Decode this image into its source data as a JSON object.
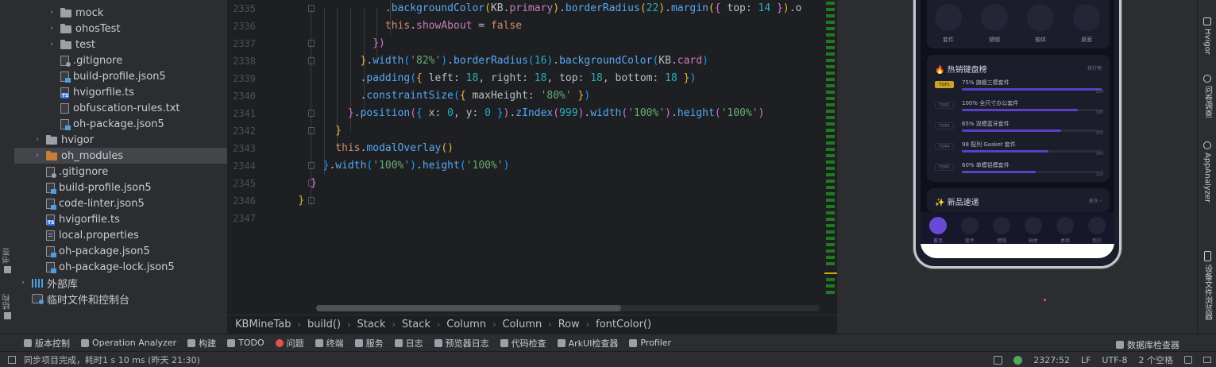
{
  "left_strip": {
    "bookmarks_label": "书签",
    "structure_label": "结构"
  },
  "tree": [
    {
      "label": "mock",
      "type": "folder",
      "chevron": "›",
      "indent": 3
    },
    {
      "label": "ohosTest",
      "type": "folder",
      "chevron": "›",
      "indent": 3
    },
    {
      "label": "test",
      "type": "folder",
      "chevron": "›",
      "indent": 3
    },
    {
      "label": ".gitignore",
      "type": "gitignore",
      "chevron": "",
      "indent": 3
    },
    {
      "label": "build-profile.json5",
      "type": "json",
      "chevron": "",
      "indent": 3
    },
    {
      "label": "hvigorfile.ts",
      "type": "ts",
      "chevron": "",
      "indent": 3
    },
    {
      "label": "obfuscation-rules.txt",
      "type": "file",
      "chevron": "",
      "indent": 3
    },
    {
      "label": "oh-package.json5",
      "type": "json",
      "chevron": "",
      "indent": 3
    },
    {
      "label": "hvigor",
      "type": "folder",
      "chevron": "›",
      "indent": 2
    },
    {
      "label": "oh_modules",
      "type": "folder-orange",
      "chevron": "›",
      "indent": 2
    },
    {
      "label": ".gitignore",
      "type": "gitignore",
      "chevron": "",
      "indent": 2
    },
    {
      "label": "build-profile.json5",
      "type": "json",
      "chevron": "",
      "indent": 2
    },
    {
      "label": "code-linter.json5",
      "type": "json",
      "chevron": "",
      "indent": 2
    },
    {
      "label": "hvigorfile.ts",
      "type": "ts",
      "chevron": "",
      "indent": 2
    },
    {
      "label": "local.properties",
      "type": "properties",
      "chevron": "",
      "indent": 2
    },
    {
      "label": "oh-package.json5",
      "type": "json",
      "chevron": "",
      "indent": 2
    },
    {
      "label": "oh-package-lock.json5",
      "type": "json",
      "chevron": "",
      "indent": 2
    },
    {
      "label": "外部库",
      "type": "lib",
      "chevron": "›",
      "indent": 1
    },
    {
      "label": "临时文件和控制台",
      "type": "scratch",
      "chevron": "",
      "indent": 1
    }
  ],
  "editor": {
    "line_numbers": [
      "2335",
      "2336",
      "2337",
      "2338",
      "2339",
      "2340",
      "2341",
      "2342",
      "2343",
      "2344",
      "2345",
      "2346",
      "2347"
    ]
  },
  "breadcrumb": [
    "KBMineTab",
    "build()",
    "Stack",
    "Stack",
    "Column",
    "Column",
    "Row",
    "fontColor()"
  ],
  "phone": {
    "quick_items": [
      "套件",
      "键帽",
      "轴体",
      "桌面"
    ],
    "hot_title": "🔥 热销键盘榜",
    "hot_more": "排行榜",
    "hot_rows": [
      {
        "badge": "TOP1",
        "name": "75% 旗舰三模套件",
        "progress": 0.99,
        "count": "320"
      },
      {
        "badge": "TOP2",
        "name": "100% 全尺寸办公套件",
        "progress": 0.82,
        "count": "190"
      },
      {
        "badge": "TOP3",
        "name": "65% 双模蓝牙套件",
        "progress": 0.7,
        "count": "150"
      },
      {
        "badge": "TOP4",
        "name": "98 配列 Gasket 套件",
        "progress": 0.61,
        "count": "140"
      },
      {
        "badge": "TOP5",
        "name": "60% 单模铝模套件",
        "progress": 0.52,
        "count": "120"
      }
    ],
    "new_title": "✨ 新品速递",
    "new_more": "更多 ›",
    "tabs": [
      "首页",
      "套件",
      "键帽",
      "轴体",
      "桌面",
      "我的"
    ]
  },
  "right_strip": {
    "hvigor": "Hvigor",
    "questions": "问卷调查",
    "app_analyzer": "AppAnalyzer",
    "device_files": "设备文件浏览器"
  },
  "bottom_tools": [
    "版本控制",
    "Operation Analyzer",
    "构建",
    "TODO",
    "问题",
    "终端",
    "服务",
    "日志",
    "预览器日志",
    "代码检查",
    "ArkUI检查器",
    "Profiler"
  ],
  "bottom_right_tool": "数据库检查器",
  "status": {
    "message": "同步项目完成，耗时1 s 10 ms (昨天 21:30)",
    "position": "2327:52",
    "line_sep": "LF",
    "encoding": "UTF-8",
    "indent": "2 个空格"
  },
  "colors": {
    "editor_bg": "#1e1f22",
    "ide_bg": "#2b2d30",
    "keyword": "#cf8e6d",
    "function": "#56a8f5",
    "string": "#6aab73",
    "number": "#2aacb8",
    "accent_purple": "#6a4ad4"
  }
}
